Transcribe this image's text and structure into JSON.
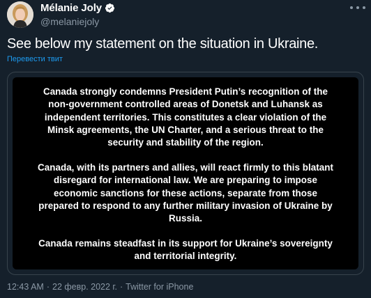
{
  "author": {
    "display_name": "Mélanie Joly",
    "handle": "@melaniejoly",
    "verified": true
  },
  "tweet": {
    "text": "See below my statement on the situation in Ukraine.",
    "translate_label": "Перевести твит",
    "statement_paragraphs": [
      "Canada strongly condemns President Putin’s recognition of the non-government controlled areas of Donetsk and Luhansk as independent territories. This constitutes a clear violation of the Minsk agreements, the UN Charter, and a serious threat to the security and stability of the region.",
      "Canada, with its partners and allies, will react firmly to this blatant disregard for international law. We are preparing to impose economic sanctions for these actions, separate from those prepared to respond to any further military invasion of Ukraine by Russia.",
      "Canada remains steadfast in its support for Ukraine’s sovereignty and territorial integrity."
    ]
  },
  "meta": {
    "time": "12:43 AM",
    "separator": "·",
    "date": "22 февр. 2022 г.",
    "source": "Twitter for iPhone"
  },
  "colors": {
    "background": "#15202b",
    "text_primary": "#ffffff",
    "text_secondary": "#8b98a5",
    "link": "#1d9bf0",
    "card_border": "#38444d",
    "statement_background": "#000000"
  },
  "icons": {
    "verified": "verified-badge-icon",
    "more": "more-options-icon"
  }
}
